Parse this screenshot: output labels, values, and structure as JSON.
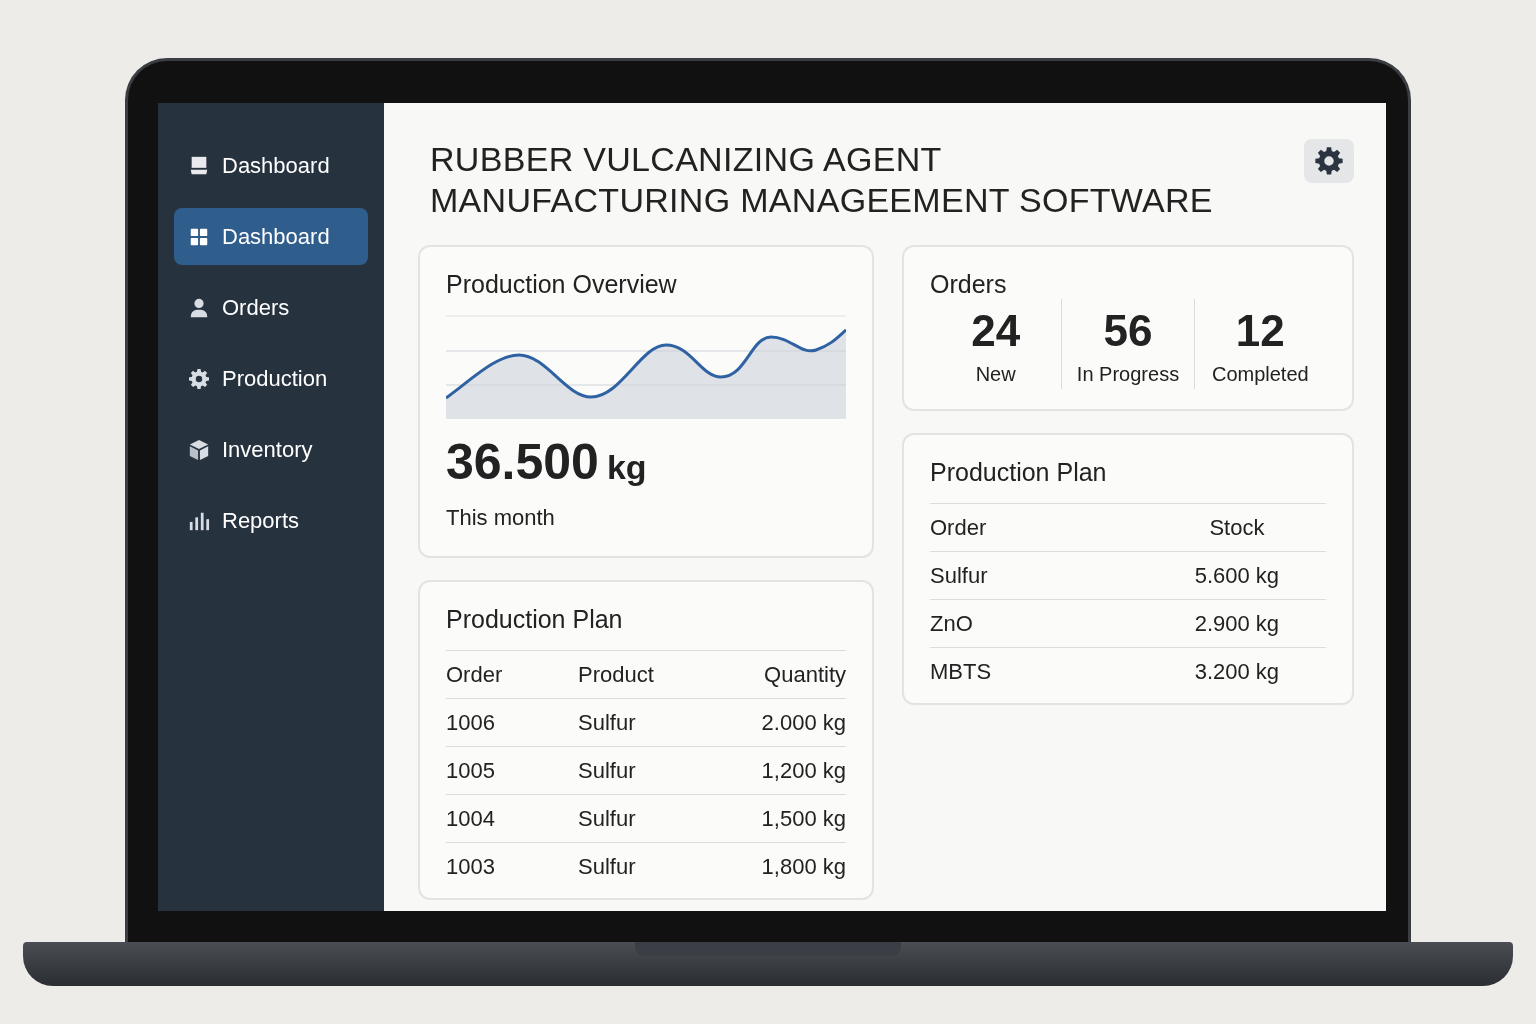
{
  "title_lines": [
    "RUBBER VULCANIZING AGENT",
    "MANUFACTURING MANAGEEMENT SOFTWARE"
  ],
  "sidebar": {
    "items": [
      {
        "label": "Dashboard",
        "selected": false
      },
      {
        "label": "Dashboard",
        "selected": true
      },
      {
        "label": "Orders",
        "selected": false
      },
      {
        "label": "Production",
        "selected": false
      },
      {
        "label": "Inventory",
        "selected": false
      },
      {
        "label": "Reports",
        "selected": false
      }
    ]
  },
  "overview": {
    "title": "Production Overview",
    "value": "36.500",
    "unit": "kg",
    "caption": "This month"
  },
  "orders": {
    "title": "Orders",
    "stats": [
      {
        "count": "24",
        "label": "New"
      },
      {
        "count": "56",
        "label": "In Progress"
      },
      {
        "count": "12",
        "label": "Completed"
      }
    ]
  },
  "production_plan": {
    "title": "Production Plan",
    "columns": [
      "Order",
      "Product",
      "Quantity"
    ],
    "rows": [
      [
        "1006",
        "Sulfur",
        "2.000 kg"
      ],
      [
        "1005",
        "Sulfur",
        "1,200 kg"
      ],
      [
        "1004",
        "Sulfur",
        "1,500 kg"
      ],
      [
        "1003",
        "Sulfur",
        "1,800 kg"
      ]
    ]
  },
  "stock_plan": {
    "title": "Production Plan",
    "columns": [
      "Order",
      "Stock"
    ],
    "rows": [
      [
        "Sulfur",
        "5.600 kg"
      ],
      [
        "ZnO",
        "2.900 kg"
      ],
      [
        "MBTS",
        "3.200 kg"
      ]
    ]
  }
}
